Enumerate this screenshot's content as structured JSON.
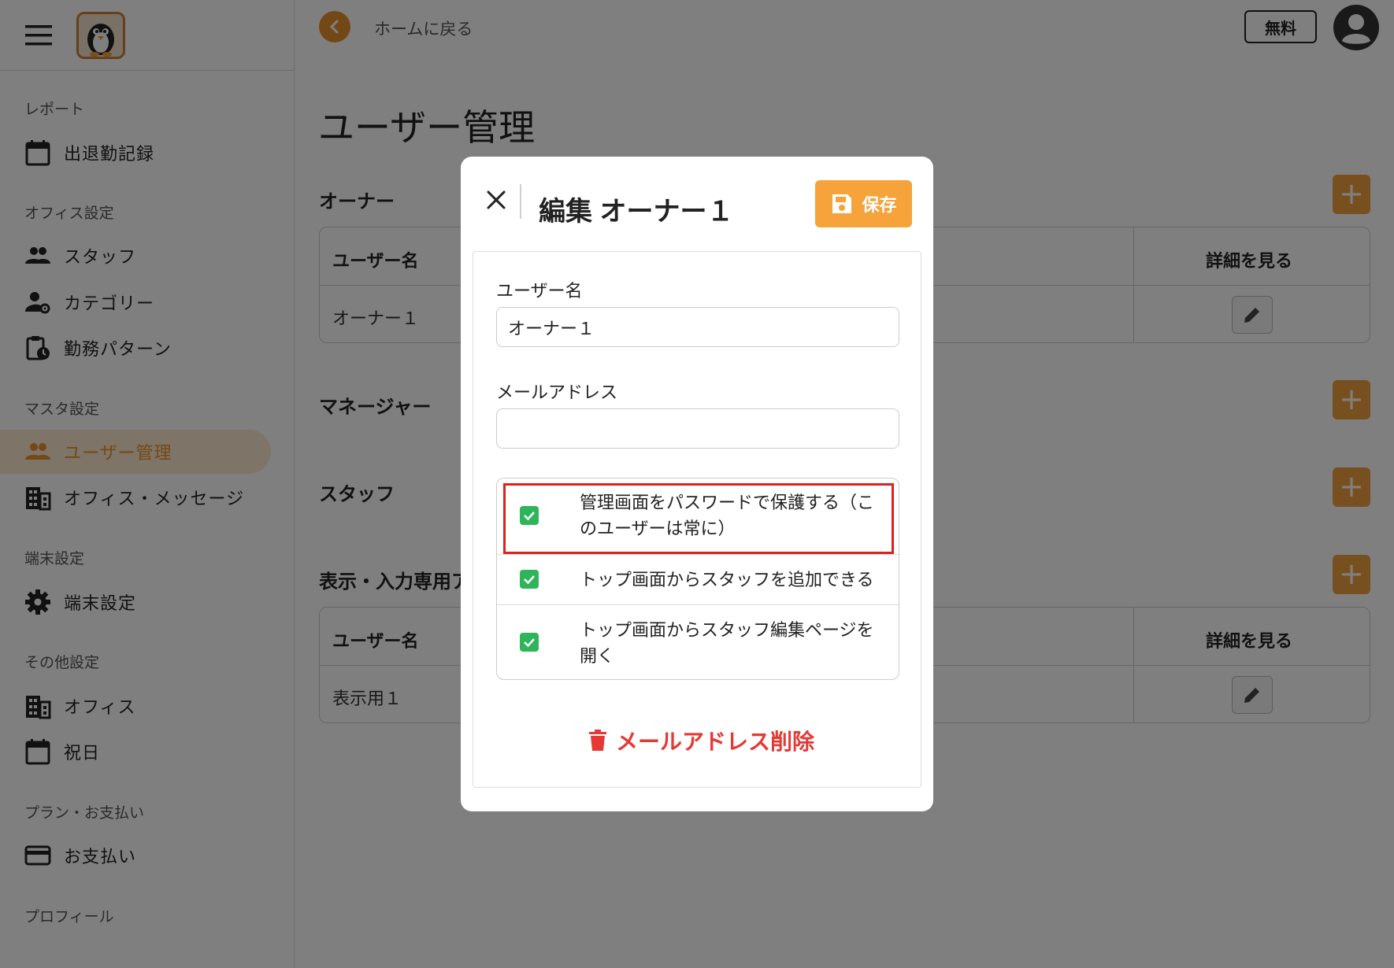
{
  "top_bar": {
    "back_label": "ホームに戻る",
    "plan_badge": "無料"
  },
  "sidebar": {
    "sections": {
      "report": "レポート",
      "office_settings": "オフィス設定",
      "master_settings": "マスタ設定",
      "device_settings": "端末設定",
      "other_settings": "その他設定",
      "plan_payment": "プラン・お支払い",
      "profile": "プロフィール"
    },
    "items": {
      "attendance": "出退勤記録",
      "staff": "スタッフ",
      "category": "カテゴリー",
      "work_pattern": "勤務パターン",
      "user_management": "ユーザー管理",
      "office_message": "オフィス・メッセージ",
      "device": "端末設定",
      "office": "オフィス",
      "holiday": "祝日",
      "payment": "お支払い"
    }
  },
  "main": {
    "title": "ユーザー管理",
    "sections": {
      "owner": "オーナー",
      "manager": "マネージャー",
      "staff": "スタッフ",
      "display": "表示・入力専用ア"
    },
    "table": {
      "col_name": "ユーザー名",
      "col_detail": "詳細を見る"
    },
    "owner_rows": [
      "オーナー１"
    ],
    "display_rows": [
      "表示用１"
    ]
  },
  "modal": {
    "title": "編集 オーナー１",
    "save_label": "保存",
    "username_label": "ユーザー名",
    "username_value": "オーナー１",
    "email_label": "メールアドレス",
    "email_value": "",
    "options": [
      {
        "label": "管理画面をパスワードで保護する（このユーザーは常に）",
        "checked": true
      },
      {
        "label": "トップ画面からスタッフを追加できる",
        "checked": true
      },
      {
        "label": "トップ画面からスタッフ編集ページを開く",
        "checked": true
      }
    ],
    "delete_email_label": "メールアドレス削除"
  },
  "colors": {
    "accent": "#f5a33a",
    "danger": "#e53935",
    "check": "#2fb45a",
    "highlight": "#e02020"
  }
}
